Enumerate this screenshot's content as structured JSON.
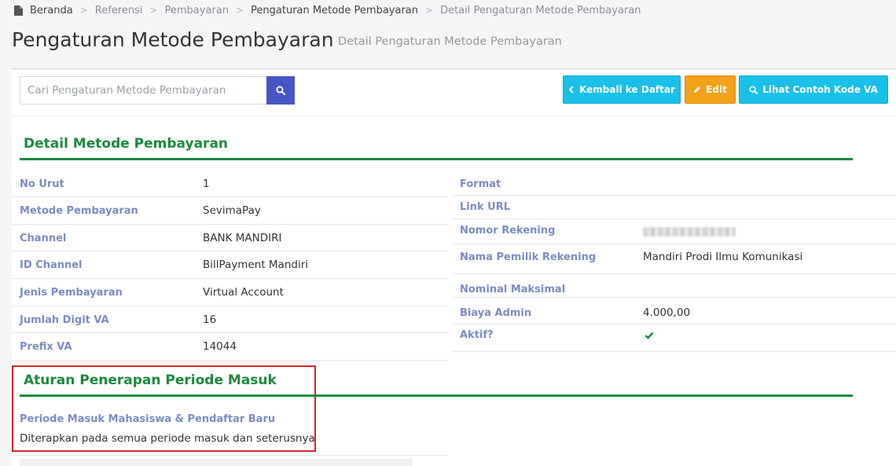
{
  "breadcrumb": {
    "items": [
      "Beranda",
      "Referensi",
      "Pembayaran",
      "Pengaturan Metode Pembayaran",
      "Detail Pengaturan Metode Pembayaran"
    ]
  },
  "header": {
    "title": "Pengaturan Metode Pembayaran",
    "subtitle": "Detail Pengaturan Metode Pembayaran"
  },
  "toolbar": {
    "search_placeholder": "Cari Pengaturan Metode Pembayaran",
    "back_label": "Kembali ke Daftar",
    "edit_label": "Edit",
    "va_label": "Lihat Contoh Kode VA"
  },
  "detail": {
    "title": "Detail Metode Pembayaran",
    "left": [
      {
        "label": "No Urut",
        "value": "1"
      },
      {
        "label": "Metode Pembayaran",
        "value": "SevimaPay"
      },
      {
        "label": "Channel",
        "value": "BANK MANDIRI"
      },
      {
        "label": "ID Channel",
        "value": "BillPayment Mandiri"
      },
      {
        "label": "Jenis Pembayaran",
        "value": "Virtual Account"
      },
      {
        "label": "Jumlah Digit VA",
        "value": "16"
      },
      {
        "label": "Prefix VA",
        "value": "14044"
      }
    ],
    "right": [
      {
        "label": "Format",
        "value": ""
      },
      {
        "label": "Link URL",
        "value": ""
      },
      {
        "label": "Nomor Rekening",
        "value": ""
      },
      {
        "label": "Nama Pemilik Rekening",
        "value": "Mandiri Prodi Ilmu Komunikasi"
      },
      {
        "label": "Nominal Maksimal",
        "value": ""
      },
      {
        "label": "Biaya Admin",
        "value": "4.000,00"
      },
      {
        "label": "Aktif?",
        "value": ""
      }
    ]
  },
  "aturan": {
    "title": "Aturan Penerapan Periode Masuk",
    "label": "Periode Masuk Mahasiswa & Pendaftar Baru",
    "value": "Diterapkan pada semua periode masuk dan seterusnya"
  },
  "colors": {
    "accent_green": "#1a8a3e",
    "label_blue": "#7a8cc4",
    "btn_cyan": "#1ac0e8",
    "btn_orange": "#f4a11a",
    "search_blue": "#4656c4",
    "highlight_red": "#d9232a"
  },
  "icons": [
    "file-icon",
    "search-icon",
    "chevron-left-icon",
    "pencil-icon",
    "check-icon"
  ]
}
